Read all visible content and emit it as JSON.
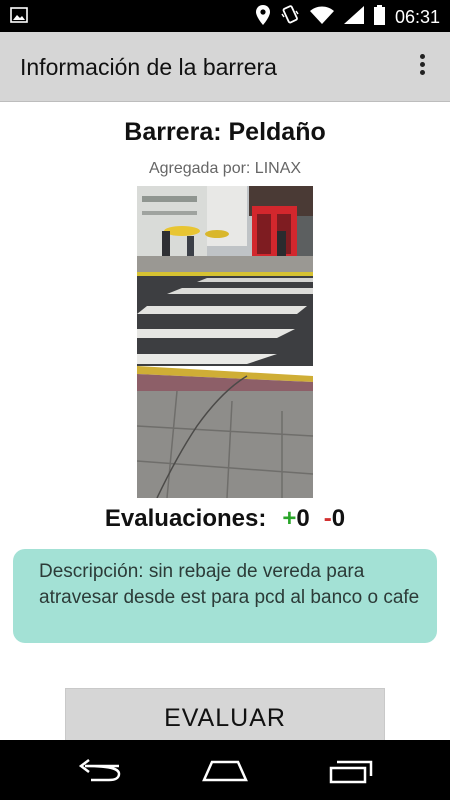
{
  "status_bar": {
    "time": "06:31",
    "icons": [
      "image-notification-icon",
      "location-icon",
      "vibrate-icon",
      "wifi-icon",
      "signal-icon",
      "battery-icon"
    ]
  },
  "app_bar": {
    "title": "Información de la barrera",
    "menu_icon": "overflow-menu-icon"
  },
  "barrier": {
    "heading": "Barrera: Peldaño",
    "added_by": "Agregada por: LINAX",
    "photo_alt": "street-crosswalk-photo"
  },
  "ratings": {
    "label": "Evaluaciones:",
    "positive_sign": "+",
    "positive_count": "0",
    "negative_sign": "-",
    "negative_count": "0"
  },
  "description": {
    "text": "Descripción: sin rebaje de vereda para atravesar desde est para pcd al banco o cafe"
  },
  "actions": {
    "evaluate_label": "EVALUAR"
  },
  "nav_bar": {
    "icons": [
      "back-icon",
      "home-icon",
      "recents-icon"
    ]
  },
  "colors": {
    "app_bar": "#d6d6d6",
    "description_bg": "#a3e1d5",
    "positive": "#2aa52a",
    "negative": "#d23030"
  }
}
